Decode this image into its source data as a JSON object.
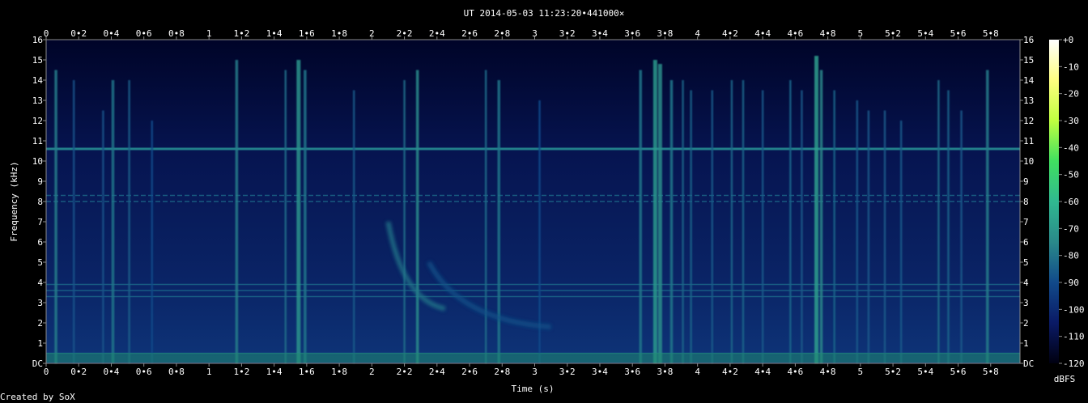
{
  "chart_data": {
    "type": "heatmap",
    "title": "UT 2014-05-03 11:23:20•441000×",
    "xlabel": "Time (s)",
    "ylabel": "Frequency (kHz)",
    "xlim": [
      0,
      5.98
    ],
    "ylim": [
      0,
      16
    ],
    "x_ticks": [
      "0",
      "0•2",
      "0•4",
      "0•6",
      "0•8",
      "1",
      "1•2",
      "1•4",
      "1•6",
      "1•8",
      "2",
      "2•2",
      "2•4",
      "2•6",
      "2•8",
      "3",
      "3•2",
      "3•4",
      "3•6",
      "3•8",
      "4",
      "4•2",
      "4•4",
      "4•6",
      "4•8",
      "5",
      "5•2",
      "5•4",
      "5•6",
      "5•8"
    ],
    "x_tick_values": [
      0,
      0.2,
      0.4,
      0.6,
      0.8,
      1,
      1.2,
      1.4,
      1.6,
      1.8,
      2,
      2.2,
      2.4,
      2.6,
      2.8,
      3,
      3.2,
      3.4,
      3.6,
      3.8,
      4,
      4.2,
      4.4,
      4.6,
      4.8,
      5,
      5.2,
      5.4,
      5.6,
      5.8
    ],
    "y_ticks": [
      "DC",
      "1",
      "2",
      "3",
      "4",
      "5",
      "6",
      "7",
      "8",
      "9",
      "10",
      "11",
      "12",
      "13",
      "14",
      "15",
      "16"
    ],
    "y_tick_values": [
      0,
      1,
      2,
      3,
      4,
      5,
      6,
      7,
      8,
      9,
      10,
      11,
      12,
      13,
      14,
      15,
      16
    ],
    "colorbar": {
      "label": "dBFS",
      "ticks": [
        "+0",
        "-10",
        "-20",
        "-30",
        "-40",
        "-50",
        "-60",
        "-70",
        "-80",
        "-90",
        "-100",
        "-110",
        "-120"
      ],
      "tick_values": [
        0,
        -10,
        -20,
        -30,
        -40,
        -50,
        -60,
        -70,
        -80,
        -90,
        -100,
        -110,
        -120
      ],
      "range": [
        -120,
        0
      ],
      "colors": [
        "#000010",
        "#0a1a66",
        "#114a8a",
        "#2a8a8a",
        "#30b890",
        "#40e060",
        "#c0ff40",
        "#ffff80",
        "#ffffff"
      ]
    },
    "horizontal_lines_khz": [
      10.6,
      8.3,
      8.0,
      3.9,
      3.6,
      3.3,
      0.5
    ],
    "broadband_events": [
      {
        "t": 0.06,
        "fmax": 14.5,
        "level": -78
      },
      {
        "t": 0.17,
        "fmax": 14.0,
        "level": -88
      },
      {
        "t": 0.35,
        "fmax": 12.5,
        "level": -88
      },
      {
        "t": 0.41,
        "fmax": 14.0,
        "level": -80
      },
      {
        "t": 0.51,
        "fmax": 14.0,
        "level": -85
      },
      {
        "t": 0.65,
        "fmax": 12.0,
        "level": -90
      },
      {
        "t": 1.17,
        "fmax": 15.0,
        "level": -78
      },
      {
        "t": 1.47,
        "fmax": 14.5,
        "level": -82
      },
      {
        "t": 1.55,
        "fmax": 15.0,
        "level": -72
      },
      {
        "t": 1.59,
        "fmax": 14.5,
        "level": -80
      },
      {
        "t": 1.89,
        "fmax": 13.5,
        "level": -86
      },
      {
        "t": 2.2,
        "fmax": 14.0,
        "level": -82
      },
      {
        "t": 2.28,
        "fmax": 14.5,
        "level": -75
      },
      {
        "t": 2.7,
        "fmax": 14.5,
        "level": -82
      },
      {
        "t": 2.78,
        "fmax": 14.0,
        "level": -80
      },
      {
        "t": 3.03,
        "fmax": 13.0,
        "level": -90
      },
      {
        "t": 3.65,
        "fmax": 14.5,
        "level": -80
      },
      {
        "t": 3.74,
        "fmax": 15.0,
        "level": -70
      },
      {
        "t": 3.77,
        "fmax": 14.8,
        "level": -74
      },
      {
        "t": 3.84,
        "fmax": 14.0,
        "level": -80
      },
      {
        "t": 3.91,
        "fmax": 14.0,
        "level": -84
      },
      {
        "t": 3.96,
        "fmax": 13.5,
        "level": -84
      },
      {
        "t": 4.09,
        "fmax": 13.5,
        "level": -86
      },
      {
        "t": 4.21,
        "fmax": 14.0,
        "level": -84
      },
      {
        "t": 4.28,
        "fmax": 14.0,
        "level": -84
      },
      {
        "t": 4.4,
        "fmax": 13.5,
        "level": -86
      },
      {
        "t": 4.57,
        "fmax": 14.0,
        "level": -84
      },
      {
        "t": 4.64,
        "fmax": 13.5,
        "level": -86
      },
      {
        "t": 4.73,
        "fmax": 15.2,
        "level": -68
      },
      {
        "t": 4.76,
        "fmax": 14.5,
        "level": -76
      },
      {
        "t": 4.84,
        "fmax": 13.5,
        "level": -84
      },
      {
        "t": 4.98,
        "fmax": 13.0,
        "level": -86
      },
      {
        "t": 5.05,
        "fmax": 12.5,
        "level": -86
      },
      {
        "t": 5.15,
        "fmax": 12.5,
        "level": -86
      },
      {
        "t": 5.25,
        "fmax": 12.0,
        "level": -86
      },
      {
        "t": 5.48,
        "fmax": 14.0,
        "level": -82
      },
      {
        "t": 5.54,
        "fmax": 13.5,
        "level": -84
      },
      {
        "t": 5.62,
        "fmax": 12.5,
        "level": -86
      },
      {
        "t": 5.78,
        "fmax": 14.5,
        "level": -78
      }
    ],
    "chirps": [
      {
        "t_start": 2.1,
        "f_start": 7.0,
        "t_end": 2.45,
        "f_end": 2.7,
        "level": -80
      },
      {
        "t_start": 2.35,
        "f_start": 5.0,
        "t_end": 3.1,
        "f_end": 1.8,
        "level": -88
      }
    ]
  },
  "footer": {
    "credit": "Created by SoX"
  }
}
